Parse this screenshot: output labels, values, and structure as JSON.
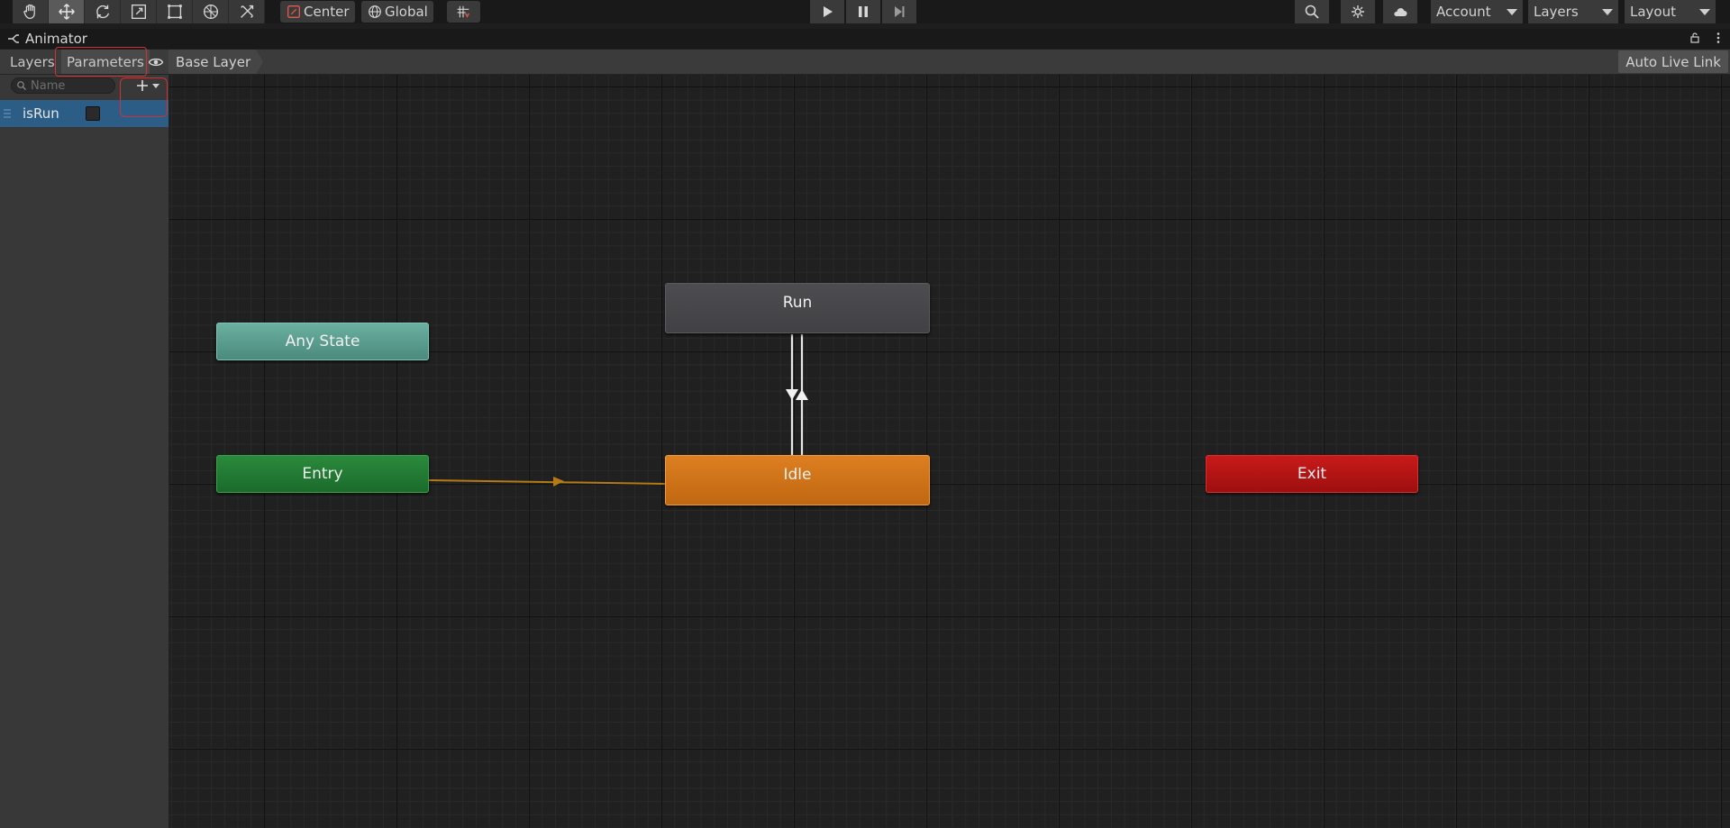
{
  "toolbar": {
    "tools": [
      {
        "name": "hand-tool-icon",
        "active": false
      },
      {
        "name": "move-tool-icon",
        "active": true
      },
      {
        "name": "rotate-tool-icon",
        "active": false
      },
      {
        "name": "scale-tool-icon",
        "active": false
      },
      {
        "name": "rect-tool-icon",
        "active": false
      },
      {
        "name": "transform-tool-icon",
        "active": false
      },
      {
        "name": "custom-tool-icon",
        "active": false
      }
    ],
    "pivot_mode": "Center",
    "pivot_rotation": "Global",
    "snap_icon": "grid-snap-icon",
    "play_controls": [
      "play-icon",
      "pause-icon",
      "step-icon"
    ],
    "right_icons": [
      "search-icon",
      "services-icon",
      "cloud-icon"
    ],
    "account_label": "Account",
    "layers_label": "Layers",
    "layout_label": "Layout"
  },
  "window": {
    "tab_title": "Animator",
    "tab_icon": "animator-icon"
  },
  "animator": {
    "tabs": [
      "Layers",
      "Parameters"
    ],
    "active_tab": "Parameters",
    "breadcrumb": "Base Layer",
    "live_link_label": "Auto Live Link",
    "search": {
      "placeholder": "Name",
      "value": ""
    },
    "parameters": [
      {
        "name": "isRun",
        "type": "bool",
        "value": false
      }
    ]
  },
  "graph": {
    "states": {
      "any_state": "Any State",
      "entry": "Entry",
      "run": "Run",
      "idle": "Idle",
      "exit": "Exit"
    },
    "colors": {
      "any_state": "#5a9e8f",
      "entry": "#22803a",
      "run": "#47474a",
      "idle": "#d5751b",
      "exit": "#b51616",
      "default_transition": "#b57a14",
      "transition": "#e8e8e8"
    },
    "transitions": [
      {
        "from": "Entry",
        "to": "Idle",
        "default": true
      },
      {
        "from": "Idle",
        "to": "Run"
      },
      {
        "from": "Run",
        "to": "Idle"
      }
    ]
  }
}
